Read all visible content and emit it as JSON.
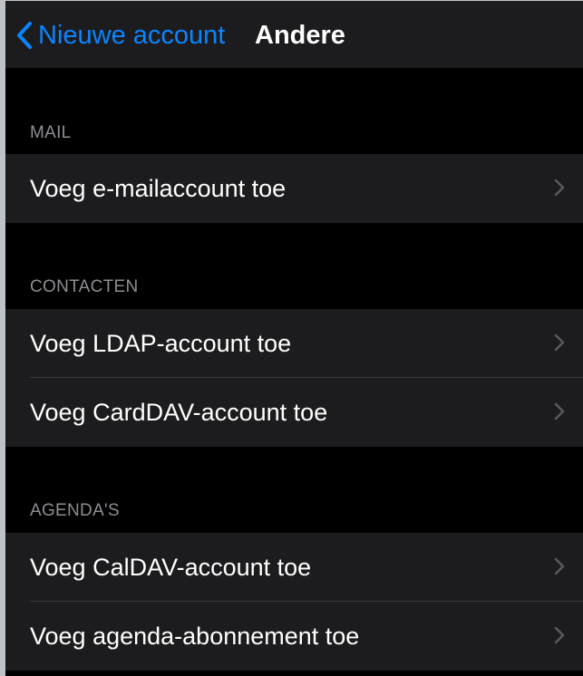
{
  "navbar": {
    "back_label": "Nieuwe account",
    "title": "Andere",
    "back_icon": "chevron-left-icon"
  },
  "sections": {
    "mail": {
      "header": "MAIL",
      "items": [
        {
          "label": "Voeg e-mailaccount toe"
        }
      ]
    },
    "contacten": {
      "header": "CONTACTEN",
      "items": [
        {
          "label": "Voeg LDAP-account toe"
        },
        {
          "label": "Voeg CardDAV-account toe"
        }
      ]
    },
    "agendas": {
      "header": "AGENDA'S",
      "items": [
        {
          "label": "Voeg CalDAV-account toe"
        },
        {
          "label": "Voeg agenda-abonnement toe"
        }
      ]
    }
  },
  "colors": {
    "accent": "#0a84ff",
    "background": "#000000",
    "cell_background": "#1c1c1e",
    "secondary_text": "#8e8e93",
    "chevron": "#5a5a5e"
  },
  "icons": {
    "row_disclosure": "chevron-right-icon"
  }
}
